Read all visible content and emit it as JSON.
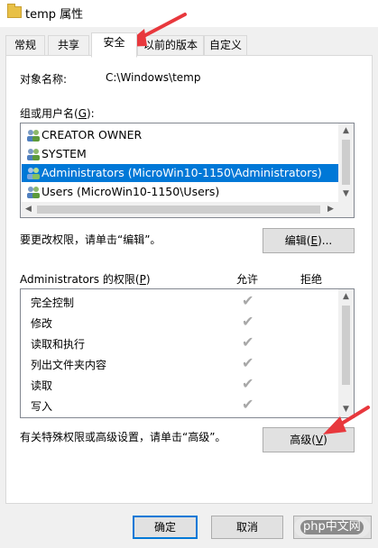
{
  "window": {
    "title": "temp 属性",
    "icon": "folder-icon"
  },
  "tabs": [
    {
      "label": "常规",
      "active": false
    },
    {
      "label": "共享",
      "active": false
    },
    {
      "label": "安全",
      "active": true
    },
    {
      "label": "以前的版本",
      "active": false
    },
    {
      "label": "自定义",
      "active": false
    }
  ],
  "object": {
    "label": "对象名称:",
    "value": "C:\\Windows\\temp"
  },
  "groups": {
    "label_prefix": "组或用户名(",
    "label_accel": "G",
    "label_suffix": "):",
    "items": [
      {
        "name": "CREATOR OWNER",
        "icon": "users-icon",
        "selected": false
      },
      {
        "name": "SYSTEM",
        "icon": "users-icon",
        "selected": false
      },
      {
        "name": "Administrators (MicroWin10-1150\\Administrators)",
        "icon": "users-icon",
        "selected": true
      },
      {
        "name": "Users (MicroWin10-1150\\Users)",
        "icon": "users-icon",
        "selected": false
      }
    ]
  },
  "edit": {
    "hint": "要更改权限，请单击“编辑”。",
    "button_prefix": "编辑(",
    "button_accel": "E",
    "button_suffix": ")..."
  },
  "permissions": {
    "label_prefix": "Administrators 的权限(",
    "label_accel": "P",
    "label_suffix": ")",
    "allow_header": "允许",
    "deny_header": "拒绝",
    "items": [
      {
        "name": "完全控制",
        "allow": true,
        "deny": false
      },
      {
        "name": "修改",
        "allow": true,
        "deny": false
      },
      {
        "name": "读取和执行",
        "allow": true,
        "deny": false
      },
      {
        "name": "列出文件夹内容",
        "allow": true,
        "deny": false
      },
      {
        "name": "读取",
        "allow": true,
        "deny": false
      },
      {
        "name": "写入",
        "allow": true,
        "deny": false
      }
    ]
  },
  "advanced": {
    "hint": "有关特殊权限或高级设置，请单击“高级”。",
    "button_prefix": "高级(",
    "button_accel": "V",
    "button_suffix": ")"
  },
  "footer": {
    "ok": "确定",
    "cancel": "取消",
    "watermark": "php中文网"
  },
  "colors": {
    "selection": "#0078d7",
    "annotation_arrow": "#e8383d"
  }
}
